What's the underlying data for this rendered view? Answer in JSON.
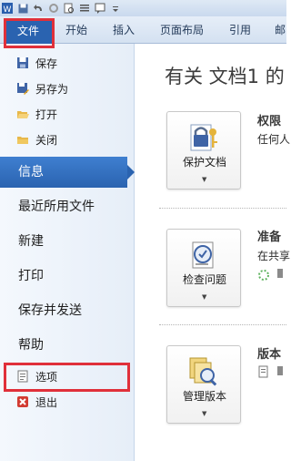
{
  "ribbon": {
    "tabs": [
      "文件",
      "开始",
      "插入",
      "页面布局",
      "引用",
      "邮"
    ]
  },
  "nav": {
    "small_items_top": [
      "保存",
      "另存为",
      "打开",
      "关闭"
    ],
    "selected": "信息",
    "big_items": [
      "最近所用文件",
      "新建",
      "打印",
      "保存并发送",
      "帮助"
    ],
    "small_items_bottom": [
      "选项",
      "退出"
    ]
  },
  "content": {
    "title": "有关 文档1 的",
    "sections": [
      {
        "button": "保护文档",
        "heading": "权限",
        "text": "任何人"
      },
      {
        "button": "检查问题",
        "heading": "准备",
        "text": "在共享"
      },
      {
        "button": "管理版本",
        "heading": "版本",
        "text": ""
      }
    ]
  },
  "colors": {
    "accent": "#2a63b0",
    "highlight": "#e0303a"
  }
}
